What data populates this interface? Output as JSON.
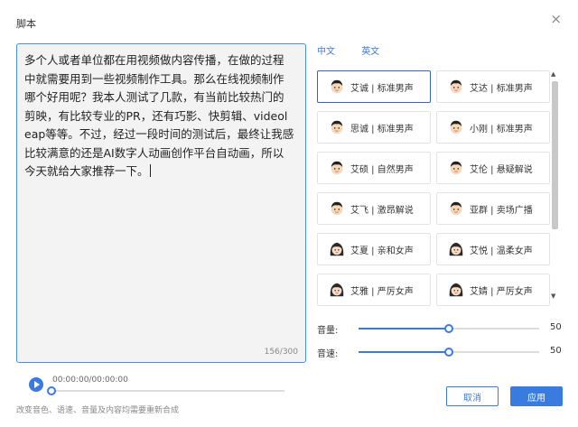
{
  "dialog": {
    "title": "脚本",
    "close_label": "×"
  },
  "editor": {
    "text": "多个人或者单位都在用视频做内容传播，在做的过程中就需要用到一些视频制作工具。那么在线视频制作哪个好用呢？我本人测试了几款，有当前比较热门的剪映，有比较专业的PR，还有巧影、快剪辑、videoleap等等。不过，经过一段时间的测试后，最终让我感比较满意的还是AI数字人动画创作平台自动画，所以今天就给大家推荐一下。",
    "counter": "156/300"
  },
  "player": {
    "time": "00:00:00/00:00:00",
    "progress": 0
  },
  "note": "改变音色、语速、音量及内容均需要重新合成",
  "language_tabs": [
    "中文",
    "英文"
  ],
  "voices": [
    {
      "label": "艾诚 | 标准男声",
      "gender": "male",
      "selected": true
    },
    {
      "label": "艾达 | 标准男声",
      "gender": "male",
      "selected": false
    },
    {
      "label": "思诚 | 标准男声",
      "gender": "male",
      "selected": false
    },
    {
      "label": "小刚 | 标准男声",
      "gender": "male",
      "selected": false
    },
    {
      "label": "艾硕 | 自然男声",
      "gender": "male",
      "selected": false
    },
    {
      "label": "艾伦 | 悬疑解说",
      "gender": "male",
      "selected": false
    },
    {
      "label": "艾飞 | 激昂解说",
      "gender": "male",
      "selected": false
    },
    {
      "label": "亚群 | 卖场广播",
      "gender": "male",
      "selected": false
    },
    {
      "label": "艾夏 | 亲和女声",
      "gender": "female",
      "selected": false
    },
    {
      "label": "艾悦 | 温柔女声",
      "gender": "female",
      "selected": false
    },
    {
      "label": "艾雅 | 严厉女声",
      "gender": "female",
      "selected": false
    },
    {
      "label": "艾婧 | 严厉女声",
      "gender": "female",
      "selected": false
    }
  ],
  "sliders": {
    "volume": {
      "label": "音量:",
      "value": "50",
      "fraction": 0.5
    },
    "speed": {
      "label": "音速:",
      "value": "50",
      "fraction": 0.5
    }
  },
  "buttons": {
    "cancel": "取消",
    "apply": "应用"
  },
  "colors": {
    "accent": "#3a7be0",
    "selected_border": "#3a5fc6"
  }
}
